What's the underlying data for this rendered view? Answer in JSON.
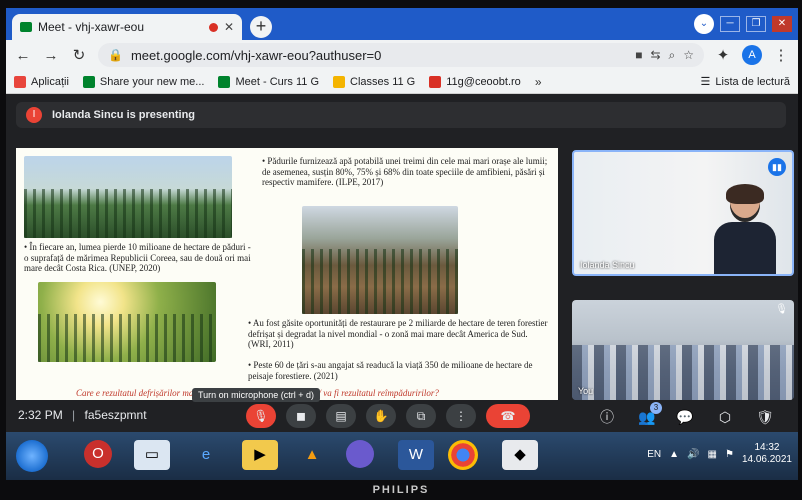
{
  "browser": {
    "tab_title": "Meet - vhj-xawr-eou",
    "tab_close": "✕",
    "new_tab": "+",
    "url": "meet.google.com/vhj-xawr-eou?authuser=0",
    "profile_initial": "A"
  },
  "bookmarks": {
    "items": [
      {
        "label": "Aplicații",
        "color": "#e8453c"
      },
      {
        "label": "Share your new me...",
        "color": "#00832d"
      },
      {
        "label": "Meet - Curs 11 G",
        "color": "#00832d"
      },
      {
        "label": "Classes 11 G",
        "color": "#f4b400"
      },
      {
        "label": "11g@ceoobt.ro",
        "color": "#d93025"
      }
    ],
    "more": "»",
    "reading_list": "Lista de lectură"
  },
  "meet": {
    "presenting_text": "Iolanda Sincu is presenting",
    "slide": {
      "t1": "• Pădurile furnizează apă potabilă unei treimi din cele mai mari orașe ale lumii; de asemenea, susțin 80%, 75% și 68% din toate speciile de amfibieni, păsări și respectiv mamifere. (ILPE, 2017)",
      "t2": "• În fiecare an, lumea pierde 10 milioane de hectare de păduri - o suprafață de mărimea Republicii Coreea, sau de două ori mai mare decât Costa Rica. (UNEP, 2020)",
      "t3": "• Au fost găsite oportunități de restaurare pe 2 miliarde de hectare de teren forestier defrișat și degradat la nivel mondial - o zonă mai mare decât America de Sud. (WRI, 2011)",
      "t4": "• Peste 60 de țări s-au angajat să readucă la viață 350 de milioane de hectare de peisaje forestiere. (2021)",
      "t5": "Care e rezultatul defrișărilor masive? Cum luăm atitudine? Care e / va fi rezultatul reîmpăduririlor?"
    },
    "tiles": {
      "teacher_name": "Iolanda Sincu",
      "class_name": "You"
    },
    "controls": {
      "time": "2:32 PM",
      "separator": "|",
      "meeting_code": "fa5eszpmnt",
      "tooltip": "Turn on microphone (ctrl + d)",
      "participants_count": "3"
    }
  },
  "taskbar": {
    "language": "EN",
    "time": "14:32",
    "date": "14.06.2021"
  },
  "monitor_brand": "PHILIPS"
}
